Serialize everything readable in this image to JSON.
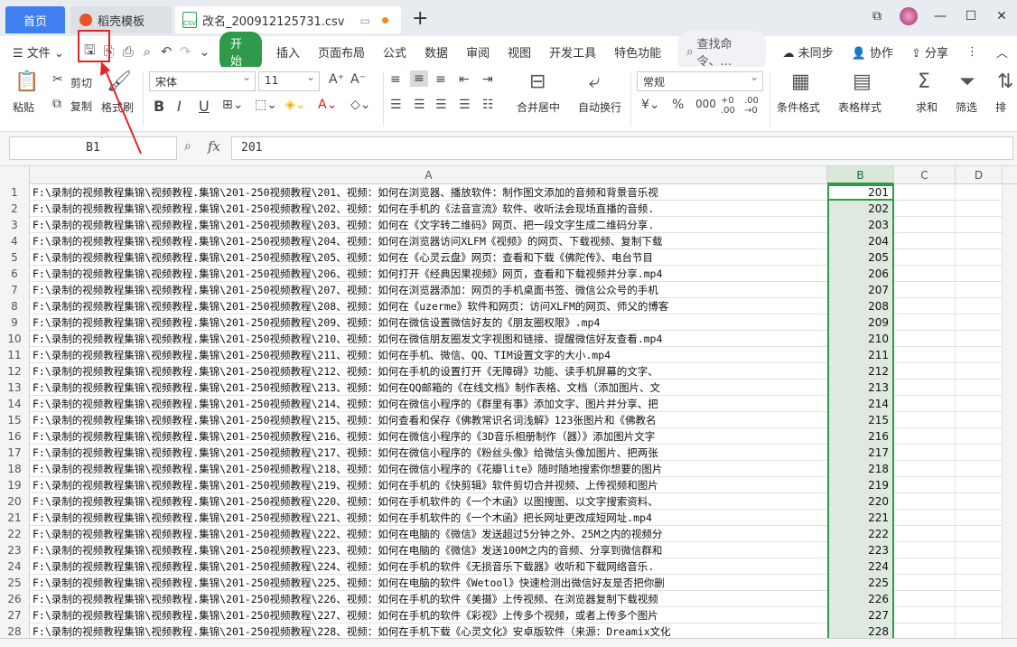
{
  "tabs": {
    "home": "首页",
    "template": "稻壳模板",
    "file": "改名_200912125731.csv",
    "file_icon": "CSV"
  },
  "menu": {
    "file": "文件",
    "start": "开始",
    "items": [
      "插入",
      "页面布局",
      "公式",
      "数据",
      "审阅",
      "视图",
      "开发工具",
      "特色功能"
    ],
    "search": "查找命令、...",
    "unsync": "未同步",
    "collab": "协作",
    "share": "分享"
  },
  "ribbon": {
    "paste": "粘贴",
    "cut": "剪切",
    "copy": "复制",
    "format_painter": "格式刷",
    "font_name": "宋体",
    "font_size": "11",
    "merge_center": "合并居中",
    "wrap": "自动换行",
    "number_format": "常规",
    "cond_format": "条件格式",
    "table_style": "表格样式",
    "sum": "求和",
    "filter": "筛选",
    "sort": "排"
  },
  "formula_bar": {
    "cell_ref": "B1",
    "fx": "fx",
    "value": "201"
  },
  "columns": [
    "A",
    "B",
    "C",
    "D"
  ],
  "rows": [
    {
      "n": "1",
      "a": "F:\\录制的视频教程集锦\\视频教程.集锦\\201-250视频教程\\201、视频：如何在浏览器、播放软件：制作图文添加的音频和背景音乐视",
      "b": "201"
    },
    {
      "n": "2",
      "a": "F:\\录制的视频教程集锦\\视频教程.集锦\\201-250视频教程\\202、视频：如何在手机的《法音宣流》软件、收听法会现场直播的音频.",
      "b": "202"
    },
    {
      "n": "3",
      "a": "F:\\录制的视频教程集锦\\视频教程.集锦\\201-250视频教程\\203、视频：如何在《文字转二维码》网页、把一段文字生成二维码分享.",
      "b": "203"
    },
    {
      "n": "4",
      "a": "F:\\录制的视频教程集锦\\视频教程.集锦\\201-250视频教程\\204、视频：如何在浏览器访问XLFM《视频》的网页、下载视频、复制下载",
      "b": "204"
    },
    {
      "n": "5",
      "a": "F:\\录制的视频教程集锦\\视频教程.集锦\\201-250视频教程\\205、视频：如何在《心灵云盘》网页：查看和下载《佛陀传》、电台节目",
      "b": "205"
    },
    {
      "n": "6",
      "a": "F:\\录制的视频教程集锦\\视频教程.集锦\\201-250视频教程\\206、视频：如何打开《经典因果视频》网页，查看和下载视频并分享.mp4",
      "b": "206"
    },
    {
      "n": "7",
      "a": "F:\\录制的视频教程集锦\\视频教程.集锦\\201-250视频教程\\207、视频：如何在浏览器添加：网页的手机桌面书签、微信公众号的手机",
      "b": "207"
    },
    {
      "n": "8",
      "a": "F:\\录制的视频教程集锦\\视频教程.集锦\\201-250视频教程\\208、视频：如何在《uzerme》软件和网页：访问XLFM的网页、师父的博客",
      "b": "208"
    },
    {
      "n": "9",
      "a": "F:\\录制的视频教程集锦\\视频教程.集锦\\201-250视频教程\\209、视频：如何在微信设置微信好友的《朋友圈权限》.mp4",
      "b": "209"
    },
    {
      "n": "10",
      "a": "F:\\录制的视频教程集锦\\视频教程.集锦\\201-250视频教程\\210、视频：如何在微信朋友圈发文字视图和链接、提醒微信好友查看.mp4",
      "b": "210"
    },
    {
      "n": "11",
      "a": "F:\\录制的视频教程集锦\\视频教程.集锦\\201-250视频教程\\211、视频：如何在手机、微信、QQ、TIM设置文字的大小.mp4",
      "b": "211"
    },
    {
      "n": "12",
      "a": "F:\\录制的视频教程集锦\\视频教程.集锦\\201-250视频教程\\212、视频：如何在手机的设置打开《无障碍》功能、读手机屏幕的文字、",
      "b": "212"
    },
    {
      "n": "13",
      "a": "F:\\录制的视频教程集锦\\视频教程.集锦\\201-250视频教程\\213、视频：如何在QQ邮箱的《在线文档》制作表格、文档（添加图片、文",
      "b": "213"
    },
    {
      "n": "14",
      "a": "F:\\录制的视频教程集锦\\视频教程.集锦\\201-250视频教程\\214、视频：如何在微信小程序的《群里有事》添加文字、图片并分享、把",
      "b": "214"
    },
    {
      "n": "15",
      "a": "F:\\录制的视频教程集锦\\视频教程.集锦\\201-250视频教程\\215、视频：如何查看和保存《佛教常识名词浅解》123张图片和《佛教名",
      "b": "215"
    },
    {
      "n": "16",
      "a": "F:\\录制的视频教程集锦\\视频教程.集锦\\201-250视频教程\\216、视频：如何在微信小程序的《3D音乐相册制作（器）》添加图片文字",
      "b": "216"
    },
    {
      "n": "17",
      "a": "F:\\录制的视频教程集锦\\视频教程.集锦\\201-250视频教程\\217、视频：如何在微信小程序的《粉丝头像》给微信头像加图片、把两张",
      "b": "217"
    },
    {
      "n": "18",
      "a": "F:\\录制的视频教程集锦\\视频教程.集锦\\201-250视频教程\\218、视频：如何在微信小程序的《花瓣lite》随时随地搜索你想要的图片",
      "b": "218"
    },
    {
      "n": "19",
      "a": "F:\\录制的视频教程集锦\\视频教程.集锦\\201-250视频教程\\219、视频：如何在手机的《快剪辑》软件剪切合并视频、上传视频和图片",
      "b": "219"
    },
    {
      "n": "20",
      "a": "F:\\录制的视频教程集锦\\视频教程.集锦\\201-250视频教程\\220、视频：如何在手机软件的《一个木函》以图搜图、以文字搜索资料、",
      "b": "220"
    },
    {
      "n": "21",
      "a": "F:\\录制的视频教程集锦\\视频教程.集锦\\201-250视频教程\\221、视频：如何在手机软件的《一个木函》把长网址更改成短网址.mp4",
      "b": "221"
    },
    {
      "n": "22",
      "a": "F:\\录制的视频教程集锦\\视频教程.集锦\\201-250视频教程\\222、视频：如何在电脑的《微信》发送超过5分钟之外、25M之内的视频分",
      "b": "222"
    },
    {
      "n": "23",
      "a": "F:\\录制的视频教程集锦\\视频教程.集锦\\201-250视频教程\\223、视频：如何在电脑的《微信》发送100M之内的音频、分享到微信群和",
      "b": "223"
    },
    {
      "n": "24",
      "a": "F:\\录制的视频教程集锦\\视频教程.集锦\\201-250视频教程\\224、视频：如何在手机的软件《无损音乐下载器》收听和下载网络音乐.",
      "b": "224"
    },
    {
      "n": "25",
      "a": "F:\\录制的视频教程集锦\\视频教程.集锦\\201-250视频教程\\225、视频：如何在电脑的软件《Wetool》快速检测出微信好友是否把你删",
      "b": "225"
    },
    {
      "n": "26",
      "a": "F:\\录制的视频教程集锦\\视频教程.集锦\\201-250视频教程\\226、视频：如何在手机的软件《美摄》上传视频、在浏览器复制下载视频",
      "b": "226"
    },
    {
      "n": "27",
      "a": "F:\\录制的视频教程集锦\\视频教程.集锦\\201-250视频教程\\227、视频：如何在手机的软件《彩视》上传多个视频，或者上传多个图片",
      "b": "227"
    },
    {
      "n": "28",
      "a": "F:\\录制的视频教程集锦\\视频教程.集锦\\201-250视频教程\\228、视频：如何在手机下载《心灵文化》安卓版软件（来源：Dreamix文化",
      "b": "228"
    }
  ],
  "colors": {
    "accent": "#2e9a4a",
    "home_tab": "#3f7ff0",
    "highlight": "#e02424"
  }
}
